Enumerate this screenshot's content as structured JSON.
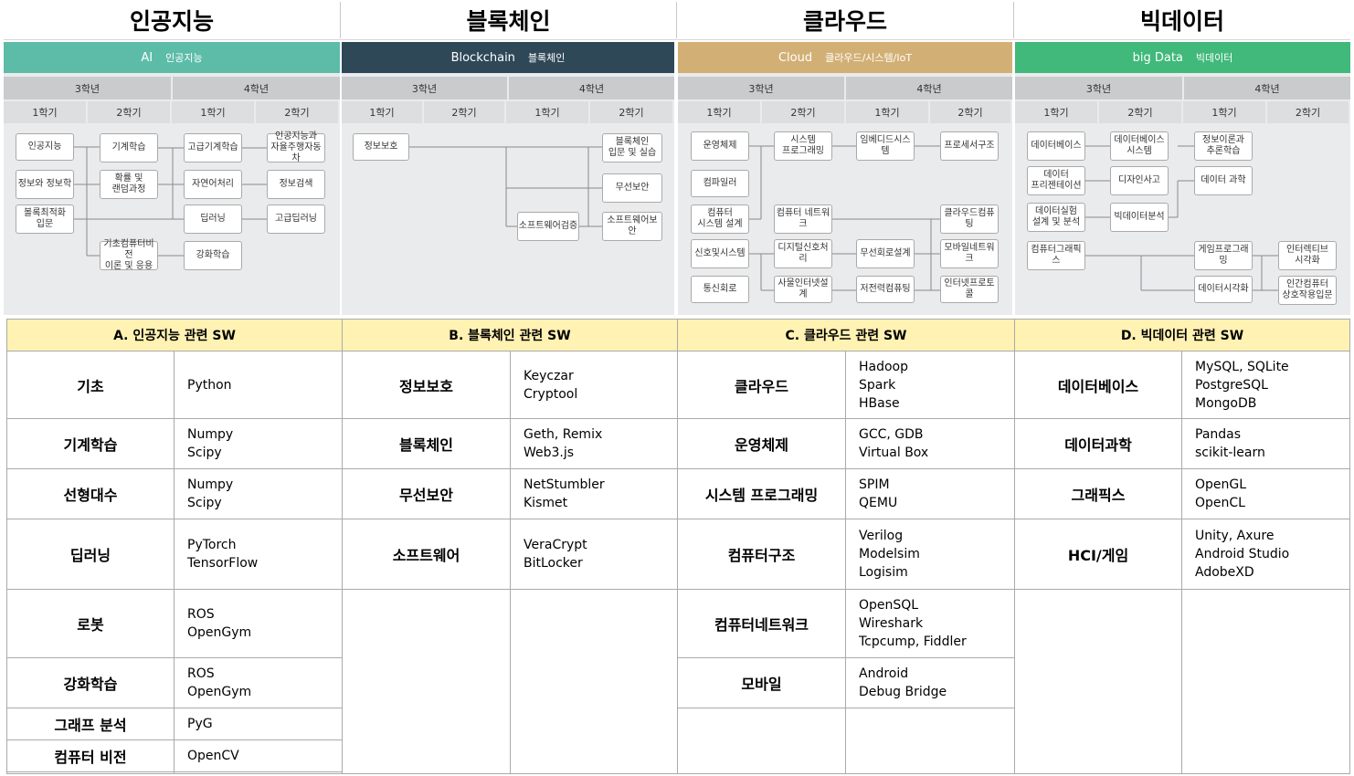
{
  "categories": [
    {
      "title": "인공지능",
      "banner_en": "AI",
      "banner_ko": "인공지능",
      "banner_color": "#5dbca8"
    },
    {
      "title": "블록체인",
      "banner_en": "Blockchain",
      "banner_ko": "블록체인",
      "banner_color": "#2f4858"
    },
    {
      "title": "클라우드",
      "banner_en": "Cloud",
      "banner_ko": "클라우드/시스템/IoT",
      "banner_color": "#d2b075"
    },
    {
      "title": "빅데이터",
      "banner_en": "big Data",
      "banner_ko": "빅데이터",
      "banner_color": "#40b97a"
    }
  ],
  "years": [
    "3학년",
    "4학년"
  ],
  "semesters": [
    "1학기",
    "2학기",
    "1학기",
    "2학기"
  ],
  "ai_courses": [
    "인공지능",
    "정보와 정보학",
    "볼록최적화\n입문",
    "기계학습",
    "확률 및\n랜덤과정",
    "기초컴퓨터비전\n이론 및 응용",
    "고급기계학습",
    "자연어처리",
    "딥러닝",
    "강화학습",
    "인공지능과\n자율주행자동차",
    "정보검색",
    "고급딥러닝"
  ],
  "bc_courses": [
    "정보보호",
    "소프트웨어검증",
    "블록체인\n입문 및 실습",
    "무선보안",
    "소프트웨어보안"
  ],
  "cl_courses": [
    "운영체제",
    "컴파일러",
    "컴퓨터\n시스템 설계",
    "신호및시스템",
    "통신회로",
    "시스템\n프로그래밍",
    "컴퓨터 네트워크",
    "디지털신호처리",
    "사물인터넷설계",
    "임베디드시스템",
    "무선회로설계",
    "저전력컴퓨팅",
    "프로세서구조",
    "클라우드컴퓨팅",
    "모바일네트워크",
    "인터넷프로토콜"
  ],
  "bd_courses": [
    "데이터베이스",
    "데이터\n프리젠테이션",
    "데이터실험\n설계 및 분석",
    "컴퓨터그래픽스",
    "데이터베이스\n시스템",
    "디자인사고",
    "빅데이터분석",
    "정보이론과\n추론학습",
    "데이터 과학",
    "게임프로그래밍",
    "데이터시각화",
    "인터렉티브\n시각화",
    "인간컴퓨터\n상호작용입문"
  ],
  "tables": [
    {
      "header": "A. 인공지능 관련 SW",
      "rows": [
        {
          "label": "기초",
          "sw": "Python"
        },
        {
          "label": "기계학습",
          "sw": "Numpy\nScipy"
        },
        {
          "label": "선형대수",
          "sw": "Numpy\nScipy"
        },
        {
          "label": "딥러닝",
          "sw": "PyTorch\nTensorFlow"
        },
        {
          "label": "로봇",
          "sw": "ROS\nOpenGym"
        },
        {
          "label": "강화학습",
          "sw": "ROS\nOpenGym"
        },
        {
          "label": "그래프 분석",
          "sw": "PyG"
        },
        {
          "label": "컴퓨터 비전",
          "sw": "OpenCV"
        }
      ]
    },
    {
      "header": "B. 블록체인 관련 SW",
      "rows": [
        {
          "label": "정보보호",
          "sw": "Keyczar\nCryptool"
        },
        {
          "label": "블록체인",
          "sw": "Geth, Remix\nWeb3.js"
        },
        {
          "label": "무선보안",
          "sw": "NetStumbler\nKismet"
        },
        {
          "label": "소프트웨어",
          "sw": "VeraCrypt\nBitLocker"
        }
      ]
    },
    {
      "header": "C. 클라우드 관련 SW",
      "rows": [
        {
          "label": "클라우드",
          "sw": "Hadoop\nSpark\nHBase"
        },
        {
          "label": "운영체제",
          "sw": "GCC, GDB\nVirtual Box"
        },
        {
          "label": "시스템 프로그래밍",
          "sw": "SPIM\nQEMU"
        },
        {
          "label": "컴퓨터구조",
          "sw": "Verilog\nModelsim\nLogisim"
        },
        {
          "label": "컴퓨터네트워크",
          "sw": "OpenSQL\nWireshark\nTcpcump, Fiddler"
        },
        {
          "label": "모바일",
          "sw": "Android\nDebug Bridge"
        }
      ]
    },
    {
      "header": "D. 빅데이터 관련 SW",
      "rows": [
        {
          "label": "데이터베이스",
          "sw": "MySQL, SQLite\nPostgreSQL\nMongoDB"
        },
        {
          "label": "데이터과학",
          "sw": "Pandas\nscikit-learn"
        },
        {
          "label": "그래픽스",
          "sw": "OpenGL\nOpenCL"
        },
        {
          "label": "HCI/게임",
          "sw": "Unity, Axure\nAndroid Studio\nAdobeXD"
        }
      ]
    }
  ]
}
